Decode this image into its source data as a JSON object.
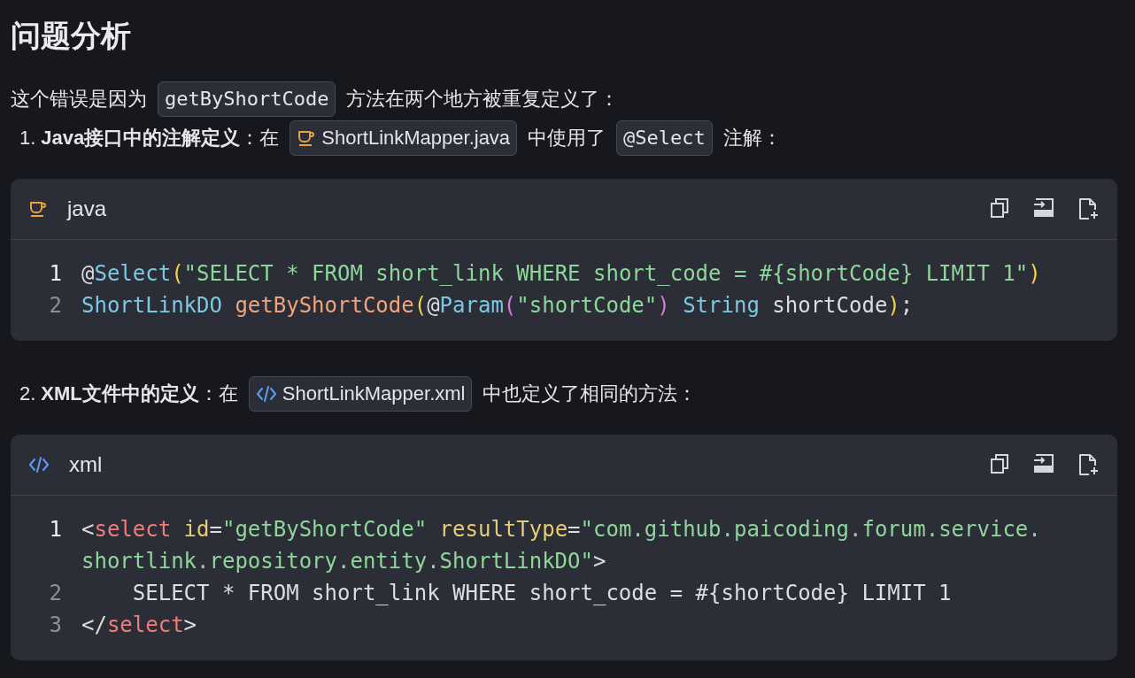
{
  "heading": "问题分析",
  "content": [
    {
      "kind": "paragraph",
      "segments": [
        {
          "kind": "text",
          "text": "这个错误是因为"
        },
        {
          "kind": "code",
          "text": "getByShortCode"
        },
        {
          "kind": "text",
          "text": "方法在两个地方被重复定义了："
        }
      ]
    },
    {
      "kind": "list_item",
      "number": "1.",
      "segments": [
        {
          "kind": "bold",
          "text": "Java接口中的注解定义"
        },
        {
          "kind": "text",
          "text": "：在"
        },
        {
          "kind": "javafile",
          "text": "ShortLinkMapper.java"
        },
        {
          "kind": "text",
          "text": "中使用了"
        },
        {
          "kind": "code",
          "text": "@Select"
        },
        {
          "kind": "text",
          "text": "注解："
        }
      ]
    },
    {
      "kind": "javablock",
      "language": "java",
      "lines": [
        {
          "number": "1",
          "active": true,
          "tokens": [
            {
              "kind": "plain",
              "text": "@"
            },
            {
              "kind": "type",
              "text": "Select"
            },
            {
              "kind": "paren",
              "text": "("
            },
            {
              "kind": "string",
              "text": "\"SELECT * FROM short_link WHERE short_code = #{shortCode} LIMIT 1\""
            },
            {
              "kind": "paren",
              "text": ")"
            }
          ]
        },
        {
          "number": "2",
          "active": false,
          "tokens": [
            {
              "kind": "type",
              "text": "ShortLinkDO "
            },
            {
              "kind": "func",
              "text": "getByShortCode"
            },
            {
              "kind": "paren",
              "text": "("
            },
            {
              "kind": "plain",
              "text": "@"
            },
            {
              "kind": "type",
              "text": "Param"
            },
            {
              "kind": "paren2",
              "text": "("
            },
            {
              "kind": "string",
              "text": "\"shortCode\""
            },
            {
              "kind": "paren2",
              "text": ") "
            },
            {
              "kind": "type",
              "text": "String "
            },
            {
              "kind": "plain",
              "text": "shortCode"
            },
            {
              "kind": "paren",
              "text": ")"
            },
            {
              "kind": "plain",
              "text": ";"
            }
          ]
        }
      ]
    },
    {
      "kind": "list_item",
      "number": "2.",
      "segments": [
        {
          "kind": "bold",
          "text": "XML文件中的定义"
        },
        {
          "kind": "text",
          "text": "：在"
        },
        {
          "kind": "xmlfile",
          "text": "ShortLinkMapper.xml"
        },
        {
          "kind": "text",
          "text": "中也定义了相同的方法："
        }
      ]
    },
    {
      "kind": "xmlblock",
      "language": "xml",
      "lines": [
        {
          "number": "1",
          "active": true,
          "tokens": [
            {
              "kind": "plain",
              "text": "<"
            },
            {
              "kind": "tag",
              "text": "select"
            },
            {
              "kind": "attr",
              "text": " id"
            },
            {
              "kind": "plain",
              "text": "="
            },
            {
              "kind": "string",
              "text": "\"getByShortCode\""
            },
            {
              "kind": "attr",
              "text": " resultType"
            },
            {
              "kind": "plain",
              "text": "="
            },
            {
              "kind": "string",
              "text": "\"com.github.paicoding.forum.service."
            }
          ]
        },
        {
          "tokens": [
            {
              "kind": "string",
              "text": "shortlink.repository.entity.ShortLinkDO\""
            },
            {
              "kind": "plain",
              "text": ">"
            }
          ]
        },
        {
          "number": "2",
          "active": false,
          "tokens": [
            {
              "kind": "plain",
              "text": "    SELECT * FROM short_link WHERE short_code = #{shortCode} LIMIT 1"
            }
          ]
        },
        {
          "number": "3",
          "active": false,
          "tokens": [
            {
              "kind": "plain",
              "text": "</"
            },
            {
              "kind": "tag",
              "text": "select"
            },
            {
              "kind": "plain",
              "text": ">"
            }
          ]
        }
      ]
    }
  ]
}
